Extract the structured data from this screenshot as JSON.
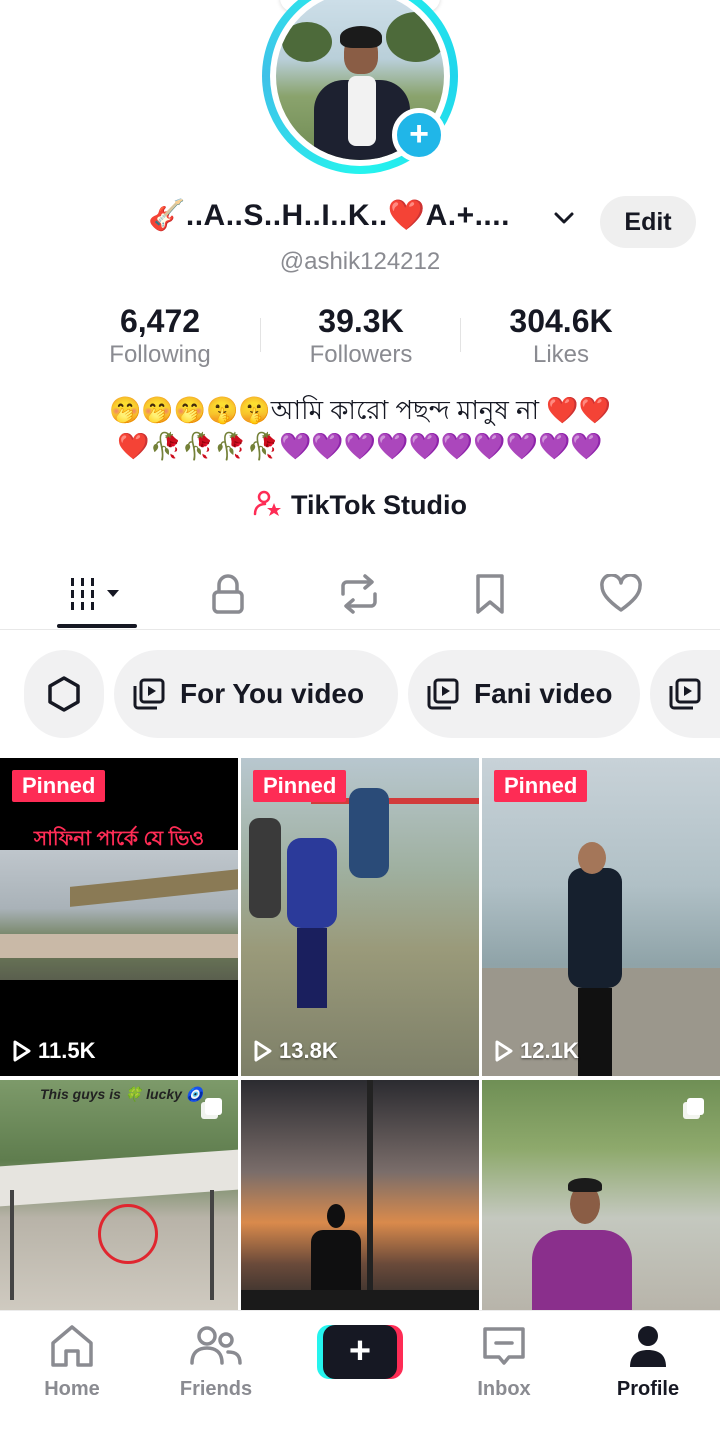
{
  "profile": {
    "display_name": "🎸..A..S..H..I..K..❤️A.+....",
    "username": "@ashik124212",
    "edit_label": "Edit"
  },
  "stats": [
    {
      "value": "6,472",
      "label": "Following"
    },
    {
      "value": "39.3K",
      "label": "Followers"
    },
    {
      "value": "304.6K",
      "label": "Likes"
    }
  ],
  "bio": {
    "line1": "🤭🤭🤭🤫🤫আমি কারো পছন্দ মানুষ না ❤️❤️",
    "line2": "❤️🥀🥀🥀🥀💜💜💜💜💜💜💜💜💜💜"
  },
  "studio_label": "TikTok Studio",
  "tabs": [
    {
      "icon": "grid-icon"
    },
    {
      "icon": "lock-icon"
    },
    {
      "icon": "repost-icon"
    },
    {
      "icon": "bookmark-icon"
    },
    {
      "icon": "heart-icon"
    }
  ],
  "chips": [
    {
      "icon": "settings-icon",
      "label": ""
    },
    {
      "icon": "playlist-icon",
      "label": "For You video"
    },
    {
      "icon": "playlist-icon",
      "label": "Fani video"
    }
  ],
  "videos": [
    {
      "pinned": "Pinned",
      "views": "11.5K",
      "overlay": "সাফিনা পার্কে যে ভিও"
    },
    {
      "pinned": "Pinned",
      "views": "13.8K"
    },
    {
      "pinned": "Pinned",
      "views": "12.1K"
    },
    {
      "caption": "This guys is 🍀 lucky 🧿"
    },
    {},
    {}
  ],
  "nav": {
    "home": "Home",
    "friends": "Friends",
    "inbox": "Inbox",
    "profile": "Profile"
  },
  "colors": {
    "accent": "#fe2c55",
    "cyan": "#25f4ee",
    "text": "#161823",
    "muted": "#8a8b91"
  }
}
